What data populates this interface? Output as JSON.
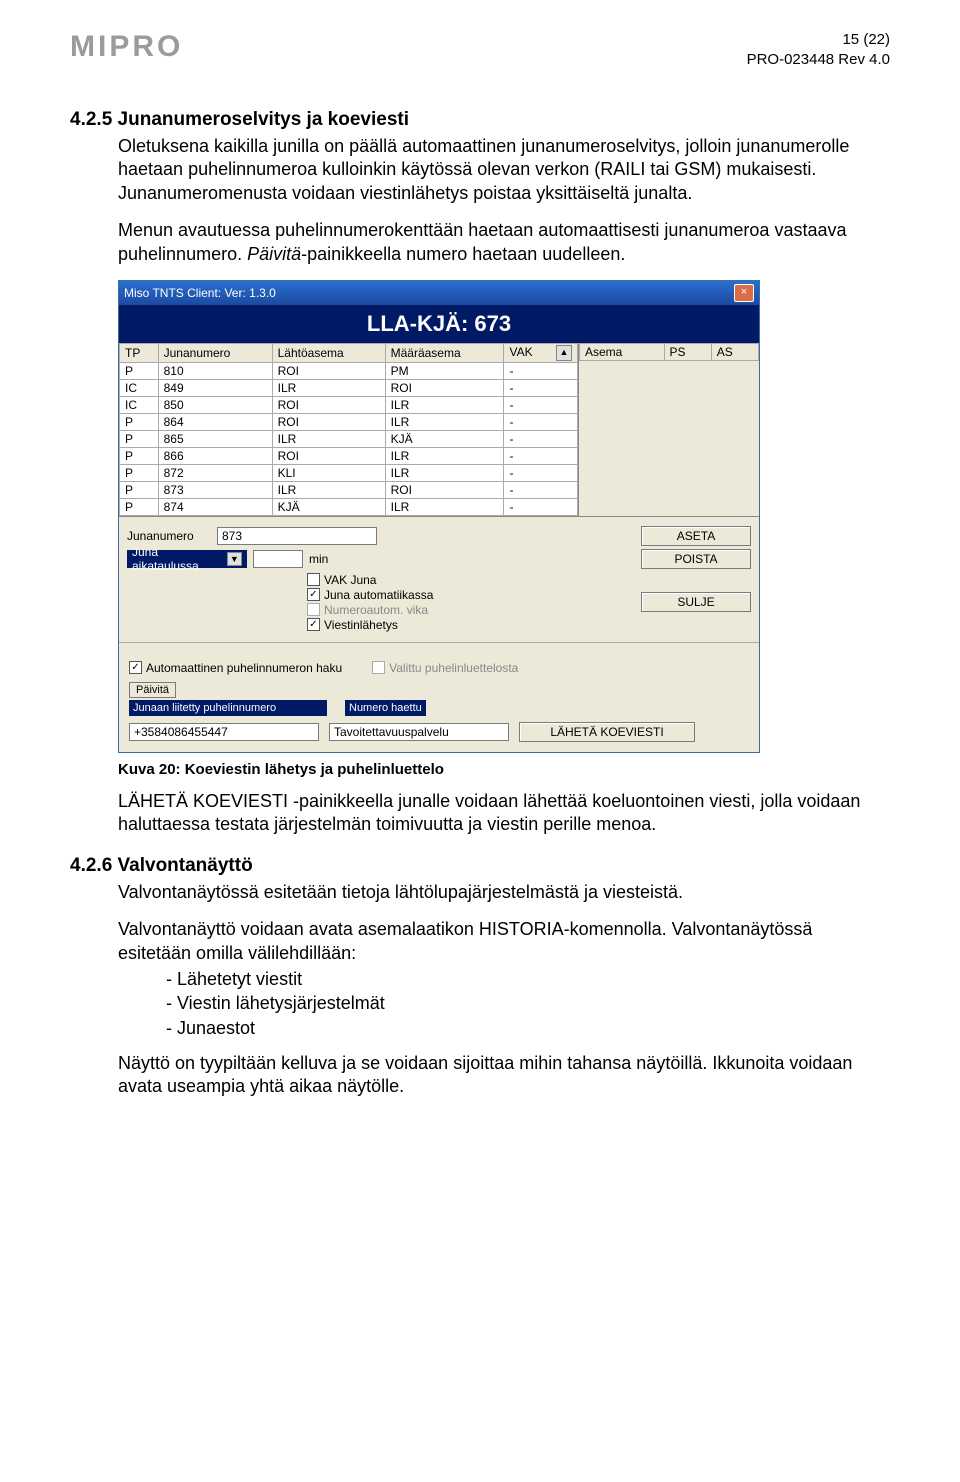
{
  "header": {
    "logo_text": "MIPRO",
    "page_of": "15 (22)",
    "doc_ref": "PRO-023448 Rev 4.0"
  },
  "sec_425": {
    "title": "4.2.5 Junanumeroselvitys ja koeviesti",
    "p1": "Oletuksena kaikilla junilla on päällä automaattinen junanumeroselvitys, jolloin junanumerolle haetaan puhelinnumeroa kulloinkin käytössä olevan verkon (RAILI tai GSM) mukaisesti. Junanumeromenusta voidaan viestinlähetys poistaa yksittäiseltä junalta.",
    "p2_a": "Menun avautuessa puhelinnumerokenttään haetaan automaattisesti junanumeroa vastaava puhelinnumero. ",
    "p2_b": "Päivitä",
    "p2_c": "-painikkeella numero haetaan uudelleen."
  },
  "window": {
    "title": "Miso TNTS Client: Ver: 1.3.0",
    "banner": "LLA-KJÄ: 673",
    "left_headers": [
      "TP",
      "Junanumero",
      "Lähtöasema",
      "Määräasema",
      "VAK"
    ],
    "right_headers": [
      "Asema",
      "PS",
      "AS"
    ],
    "rows": [
      [
        "P",
        "810",
        "ROI",
        "PM",
        "-"
      ],
      [
        "IC",
        "849",
        "ILR",
        "ROI",
        "-"
      ],
      [
        "IC",
        "850",
        "ROI",
        "ILR",
        "-"
      ],
      [
        "P",
        "864",
        "ROI",
        "ILR",
        "-"
      ],
      [
        "P",
        "865",
        "ILR",
        "KJÄ",
        "-"
      ],
      [
        "P",
        "866",
        "ROI",
        "ILR",
        "-"
      ],
      [
        "P",
        "872",
        "KLI",
        "ILR",
        "-"
      ],
      [
        "P",
        "873",
        "ILR",
        "ROI",
        "-"
      ],
      [
        "P",
        "874",
        "KJÄ",
        "ILR",
        "-"
      ]
    ],
    "junanumero_label": "Junanumero",
    "junanumero_value": "873",
    "aseta_btn": "ASETA",
    "dropdown_text": "Juna aikataulussa",
    "min_label": "min",
    "poista_btn": "POISTA",
    "chk_vak": "VAK Juna",
    "chk_autom": "Juna automatiikassa",
    "chk_numvika": "Numeroautom. vika",
    "chk_viest": "Viestinlähetys",
    "sulje_btn": "SULJE",
    "chk_autohaku": "Automaattinen puhelinnumeron haku",
    "chk_valittu": "Valittu puhelinluettelosta",
    "paivita_btn": "Päivitä",
    "label_puh": "Junaan liitetty puhelinnumero",
    "label_numero_haettu": "Numero haettu",
    "puh_value": "+3584086455447",
    "tavo_value": "Tavoitettavuuspalvelu",
    "laheta_btn": "LÄHETÄ KOEVIESTI"
  },
  "caption20": "Kuva 20: Koeviestin lähetys ja puhelinluettelo",
  "after_fig": "LÄHETÄ KOEVIESTI -painikkeella junalle voidaan lähettää koeluontoinen viesti, jolla voidaan haluttaessa testata järjestelmän toimivuutta ja viestin perille menoa.",
  "sec_426": {
    "title": "4.2.6 Valvontanäyttö",
    "p1": "Valvontanäytössä esitetään tietoja lähtölupajärjestelmästä ja viesteistä.",
    "p2": "Valvontanäyttö voidaan avata asemalaatikon HISTORIA-komennolla. Valvontanäytössä esitetään omilla välilehdillään:",
    "bullets": [
      "Lähetetyt viestit",
      "Viestin lähetysjärjestelmät",
      "Junaestot"
    ],
    "p3": "Näyttö on tyypiltään kelluva ja se voidaan sijoittaa mihin tahansa näytöillä. Ikkunoita voidaan avata useampia yhtä aikaa näytölle."
  }
}
